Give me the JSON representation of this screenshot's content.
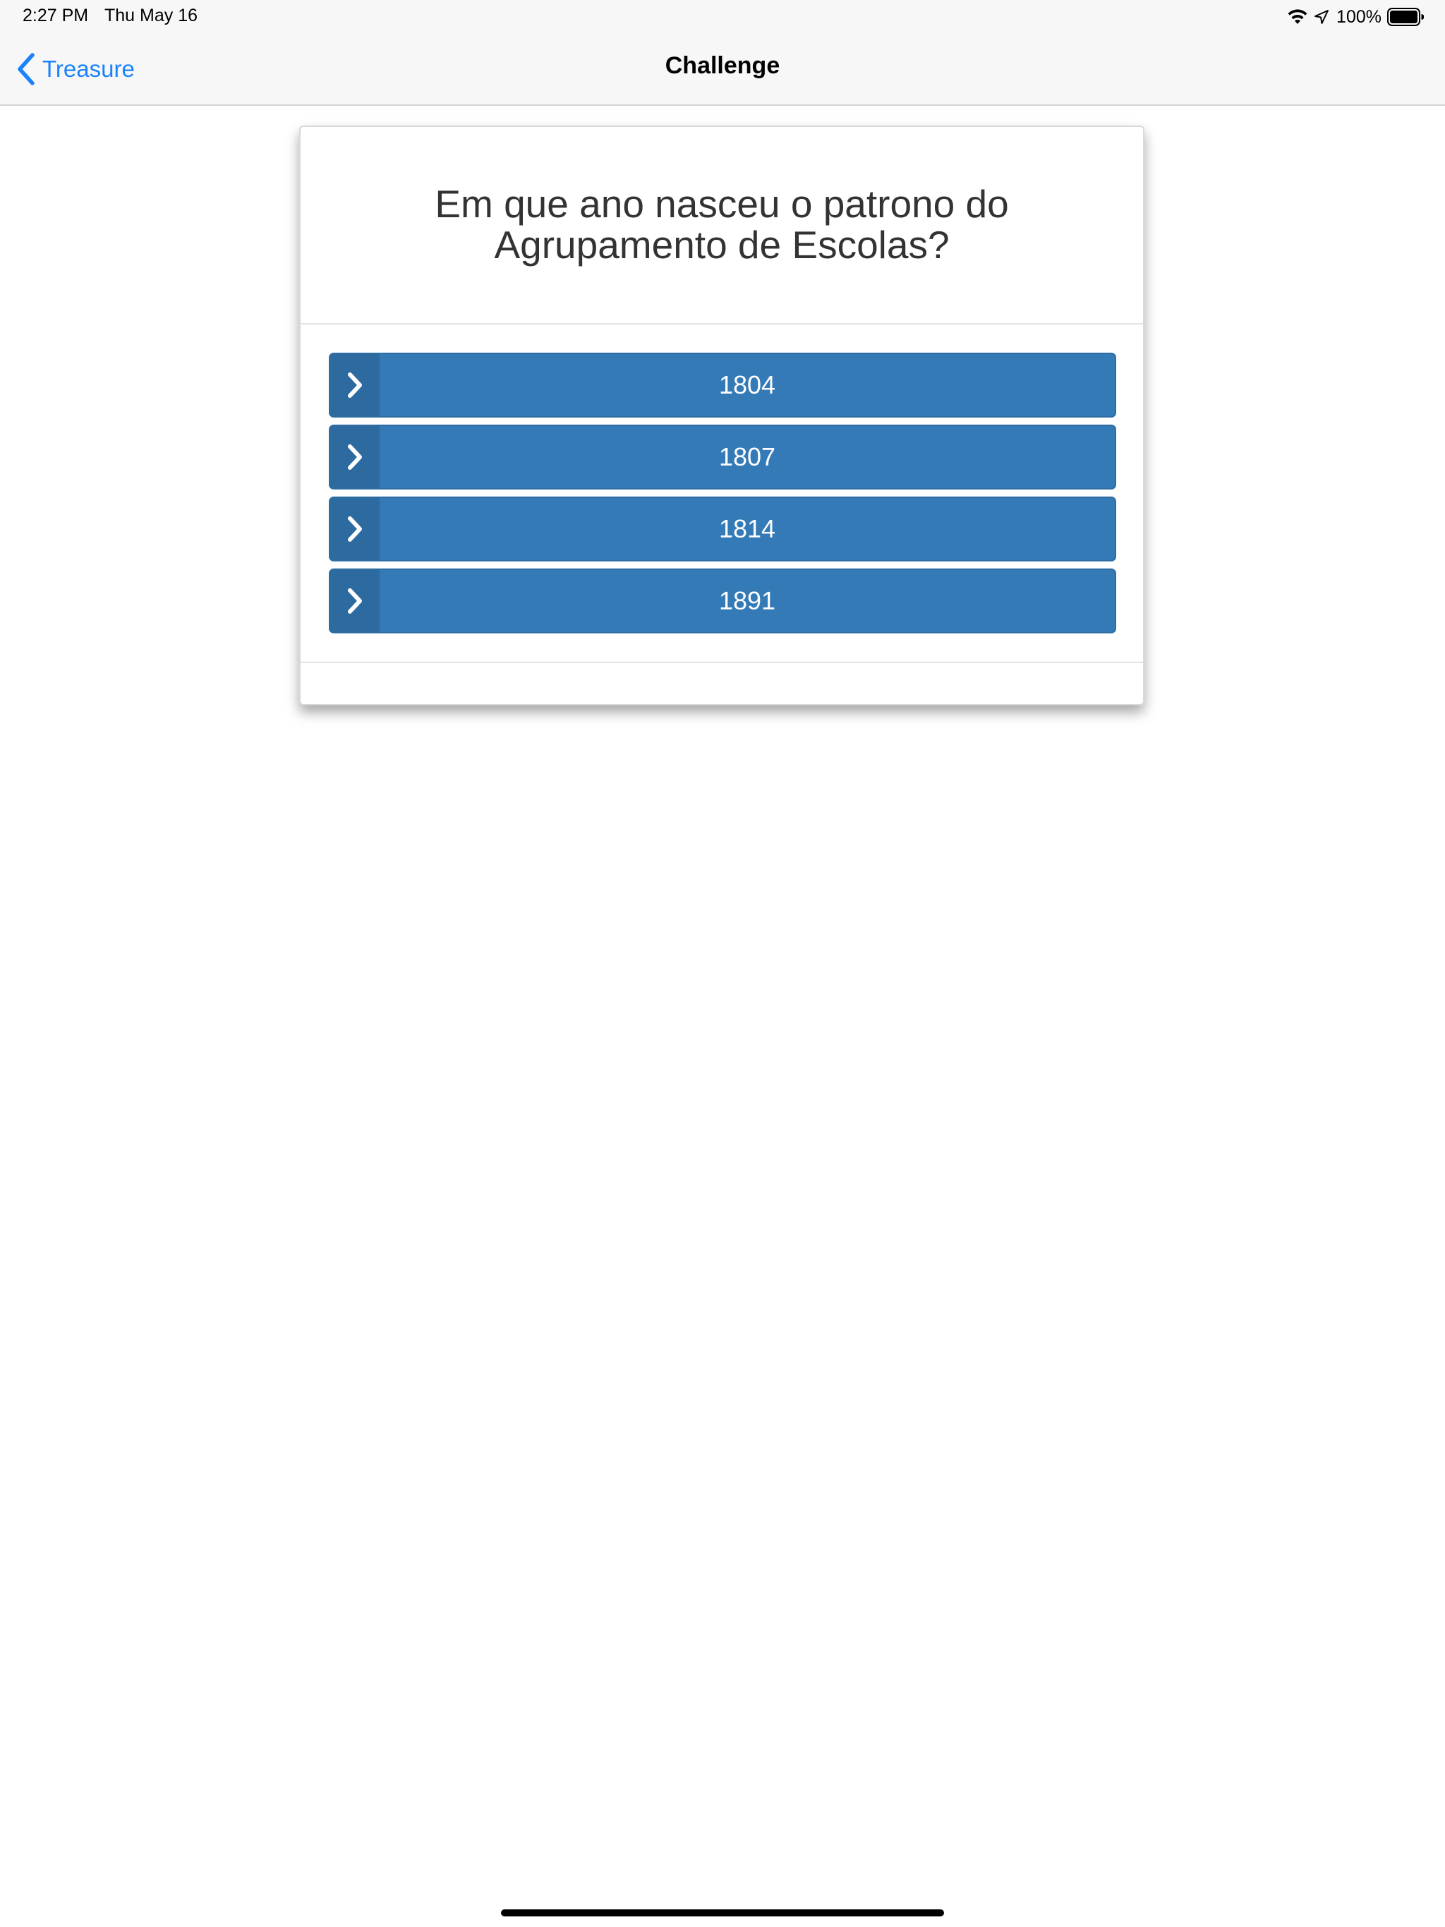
{
  "status_bar": {
    "time": "2:27 PM",
    "date": "Thu May 16",
    "battery_percent": "100%",
    "icons": [
      "wifi-icon",
      "location-arrow-icon",
      "battery-icon"
    ]
  },
  "nav": {
    "back_label": "Treasure",
    "title": "Challenge"
  },
  "question": {
    "text": "Em que ano nasceu o patrono do Agrupamento de Escolas?"
  },
  "answers": [
    {
      "label": "1804"
    },
    {
      "label": "1807"
    },
    {
      "label": "1814"
    },
    {
      "label": "1891"
    }
  ],
  "colors": {
    "accent": "#1a82fb",
    "button": "#337ab7",
    "button_icon_box": "#2d6aa0"
  }
}
